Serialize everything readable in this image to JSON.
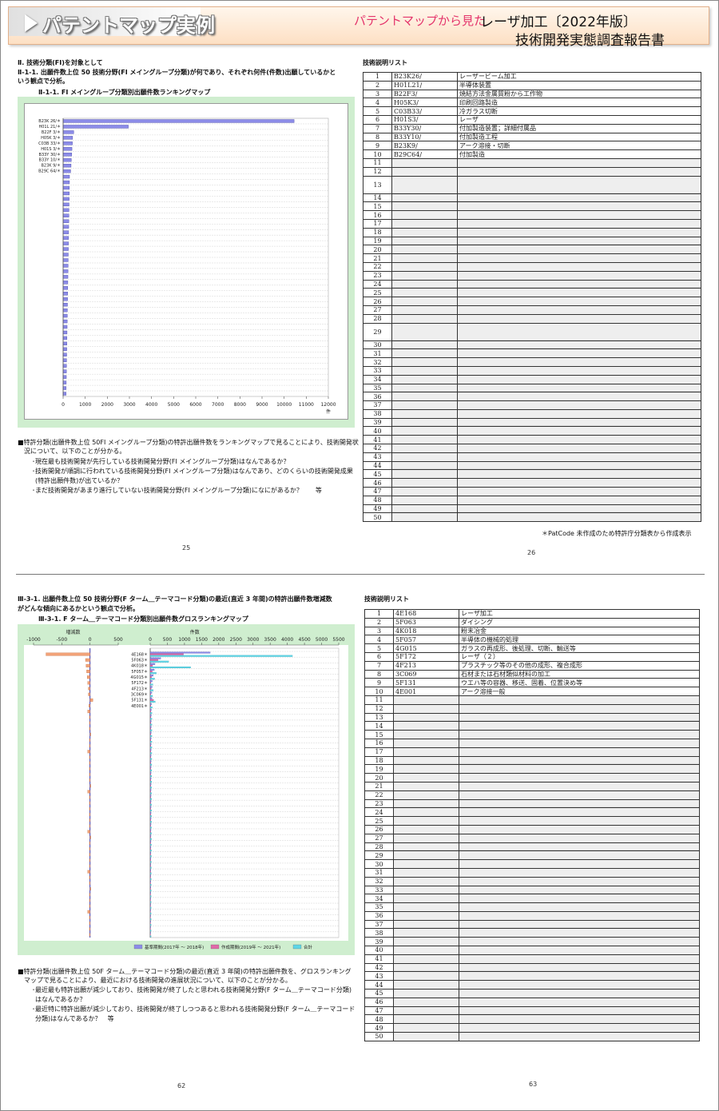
{
  "header": {
    "title": "パテントマップ実例",
    "subtitle": "パテントマップから見た",
    "report_line1": "レーザ加工〔2022年版〕",
    "report_line2": "技術開発実態調査報告書"
  },
  "top_left": {
    "section": "Ⅱ. 技術分類(FI)を対象として",
    "heading_line1": "Ⅱ-1-1. 出願件数上位 50 技術分野(FI メイングループ分類)が何であり、それぞれ何件(件数)出願しているかと",
    "heading_line2": "いう観点で分析。",
    "chart_title": "Ⅱ-1-1. FI メイングループ分類別出願件数ランキングマップ",
    "note_line1": "■特許分類(出願件数上位 50FI メイングループ分類)の特許出願件数をランキングマップで見ることにより、技術開発状",
    "note_line2": "況について、以下のことが分かる。",
    "bullet1": "･現在最も技術開発が先行している技術開発分野(FI メイングループ分類)はなんであるか？",
    "bullet2": "･技術開発が順調に行われている技術開発分野(FI メイングループ分類)はなんであり、どのくらいの技術開発成果",
    "bullet2b": "(特許出願件数)が出ているか？",
    "bullet3": "･まだ技術開発があまり進行していない技術開発分野(FI メイングループ分類)になにがあるか？　　等",
    "page": "25"
  },
  "top_right": {
    "list_title": "技術説明リスト",
    "footnote": "＊PatCode 未作成のため特許庁分類表から作成表示",
    "page": "26"
  },
  "bottom_left": {
    "heading_line1": "Ⅲ-3-1. 出願件数上位 50 技術分野(F ターム＿テーマコード分類)の最近(直近 3 年間)の特許出願件数増減数",
    "heading_line2": "がどんな傾向にあるかという観点で分析。",
    "chart_title": "Ⅲ-3-1. F ターム＿テーマコード分類別出願件数グロスランキングマップ",
    "note_line1": "■特許分類(出願件数上位 50F ターム＿テーマコード分類)の最近(直近 3 年間)の特許出願件数を、グロスランキング",
    "note_line2": "マップで見ることにより、最近における技術開発の進展状況について、以下のことが分かる。",
    "bullet1": "･最近最も特許出願が減少しており、技術開発が終了したと思われる技術開発分野(F ターム＿テーマコード分類)",
    "bullet1b": "はなんであるか？",
    "bullet2": "･最近特に特許出願が減少しており、技術開発が終了しつつあると思われる技術開発分野(F ターム＿テーマコード",
    "bullet2b": "分類)はなんであるか？　等",
    "page": "62"
  },
  "bottom_right": {
    "list_title": "技術説明リスト",
    "page": "63"
  },
  "list1": [
    {
      "no": "1",
      "code": "B23K26/",
      "desc": "レーザービーム加工"
    },
    {
      "no": "2",
      "code": "H01L21/",
      "desc": "半導体装置"
    },
    {
      "no": "3",
      "code": "B22F3/",
      "desc": "焼結方法金属質粉から工作物"
    },
    {
      "no": "4",
      "code": "H05K3/",
      "desc": "印刷回路製造"
    },
    {
      "no": "5",
      "code": "C03B33/",
      "desc": "冷ガラス切断"
    },
    {
      "no": "6",
      "code": "H01S3/",
      "desc": "レーザ"
    },
    {
      "no": "7",
      "code": "B33Y30/",
      "desc": "付加製造装置；詳細付属品"
    },
    {
      "no": "8",
      "code": "B33Y10/",
      "desc": "付加製造工程"
    },
    {
      "no": "9",
      "code": "B23K9/",
      "desc": "アーク溶接・切断"
    },
    {
      "no": "10",
      "code": "B29C64/",
      "desc": "付加製造"
    }
  ],
  "list2": [
    {
      "no": "1",
      "code": "4E168",
      "desc": "レーザ加工"
    },
    {
      "no": "2",
      "code": "5F063",
      "desc": "ダイシング"
    },
    {
      "no": "3",
      "code": "4K018",
      "desc": "粉末冶金"
    },
    {
      "no": "4",
      "code": "5F057",
      "desc": "半導体の機械的処理"
    },
    {
      "no": "5",
      "code": "4G015",
      "desc": "ガラスの再成形、後処理、切断、輸送等"
    },
    {
      "no": "6",
      "code": "5F172",
      "desc": "レーザ（２）"
    },
    {
      "no": "7",
      "code": "4F213",
      "desc": "プラスチック等のその他の成形、複合成形"
    },
    {
      "no": "8",
      "code": "3C069",
      "desc": "石材または石材類似材料の加工"
    },
    {
      "no": "9",
      "code": "5F131",
      "desc": "ウエハ等の容器、移送、固着、位置決め等"
    },
    {
      "no": "10",
      "code": "4E001",
      "desc": "アーク溶接一般"
    }
  ],
  "chart_data": [
    {
      "type": "bar",
      "orientation": "horizontal",
      "title": "Ⅱ-1-1. FI メイングループ分類別出願件数ランキングマップ",
      "categories": [
        "B23K 26/＊",
        "H01L 21/＊",
        "B22F 3/＊",
        "H05K 3/＊",
        "C03B 33/＊",
        "H01S 3/＊",
        "B33Y 30/＊",
        "B33Y 10/＊",
        "B23K 9/＊",
        "B29C 64/＊"
      ],
      "values": [
        10450,
        2950,
        480,
        430,
        420,
        400,
        390,
        370,
        360,
        340
      ],
      "xticks": [
        "0",
        "1000",
        "2000",
        "3000",
        "4000",
        "5000",
        "6000",
        "7000",
        "8000",
        "9000",
        "10000",
        "11000",
        "12000"
      ],
      "xunit": "件",
      "xlim": [
        0,
        12000
      ]
    },
    {
      "type": "bar",
      "orientation": "horizontal",
      "title": "Ⅲ-3-1. F ターム＿テーマコード分類別出願件数グロスランキングマップ",
      "categories": [
        "4E168＊",
        "5F063＊",
        "4K018＊",
        "5F057＊",
        "4G015＊",
        "5F172＊",
        "4F213＊",
        "3C069＊",
        "5F131＊",
        "4E001＊"
      ],
      "left_axis_label": "増減数",
      "left_ticks": [
        "-1000",
        "-500",
        "0",
        "500"
      ],
      "left_xlim": [
        -1000,
        500
      ],
      "right_axis_label": "件数",
      "right_ticks": [
        "0",
        "500",
        "1000",
        "1500",
        "2000",
        "2500",
        "3000",
        "3500",
        "4000",
        "4500",
        "5000",
        "5500"
      ],
      "right_xlim": [
        0,
        5500
      ],
      "change": [
        -780,
        -80,
        -70,
        -60,
        -50,
        -40,
        -30,
        -30,
        50,
        -20
      ],
      "series": [
        {
          "name": "基準期間(2017年 ～ 2018年)",
          "values": [
            1750,
            310,
            140,
            120,
            90,
            60,
            60,
            50,
            50,
            40
          ]
        },
        {
          "name": "作成期間(2019年 ～ 2021年)",
          "values": [
            970,
            230,
            70,
            60,
            40,
            20,
            30,
            20,
            100,
            20
          ]
        },
        {
          "name": "合計",
          "values": [
            4150,
            540,
            1180,
            180,
            130,
            80,
            90,
            70,
            150,
            60
          ]
        }
      ],
      "colors": {
        "base": "#8c8ce8",
        "recent": "#e06aa8",
        "total": "#5ed5e6",
        "change": "#f2a278"
      }
    }
  ]
}
